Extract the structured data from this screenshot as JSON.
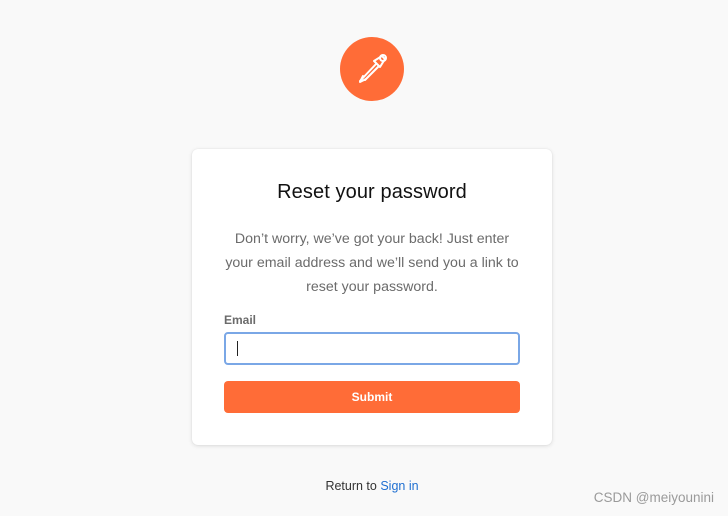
{
  "logo": {
    "icon": "postman-astronaut-icon",
    "color": "#ff6c37"
  },
  "card": {
    "title": "Reset your password",
    "description": "Don’t worry, we’ve got your back! Just enter your email address and we’ll send you a link to reset your password.",
    "email_label": "Email",
    "email_value": "",
    "submit_label": "Submit"
  },
  "footer": {
    "return_text": "Return to ",
    "sign_in_label": "Sign in"
  },
  "watermark": "CSDN @meiyounini",
  "colors": {
    "accent": "#ff6c37",
    "link": "#1f6fd1",
    "input_focus": "#7aa7e6"
  }
}
